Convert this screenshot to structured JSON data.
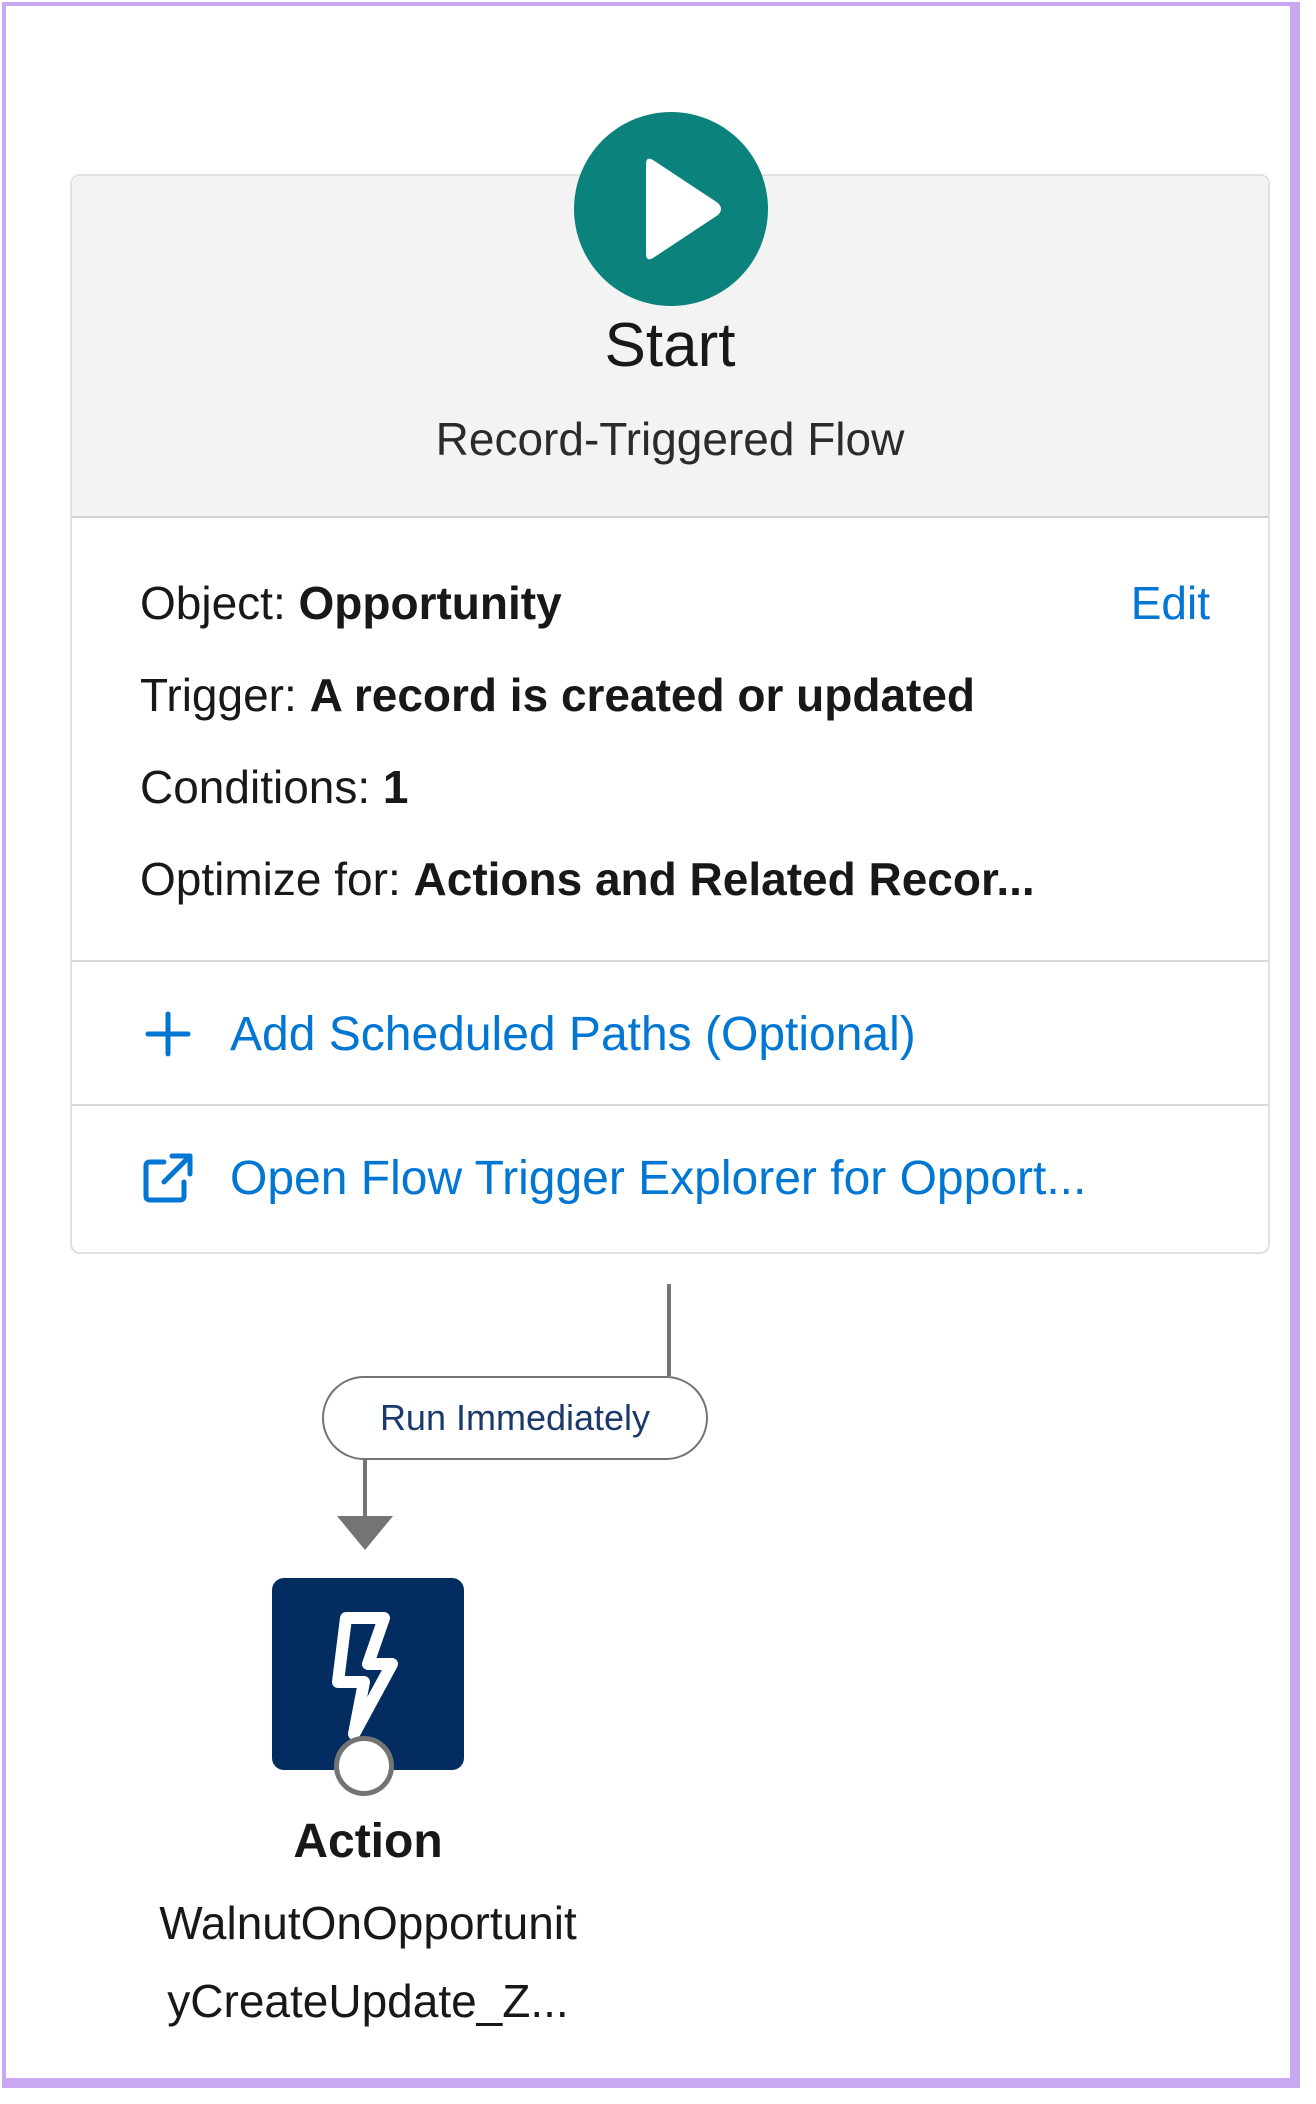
{
  "start": {
    "title": "Start",
    "subtitle": "Record-Triggered Flow",
    "icon": "play-icon",
    "icon_color": "#0b827c"
  },
  "details": {
    "object_label": "Object:",
    "object_value": "Opportunity",
    "edit_label": "Edit",
    "trigger_label": "Trigger:",
    "trigger_value": "A record is created or updated",
    "conditions_label": "Conditions:",
    "conditions_value": "1",
    "optimize_label": "Optimize for:",
    "optimize_value": "Actions and Related Recor..."
  },
  "links": {
    "add_scheduled_paths": "Add Scheduled Paths (Optional)",
    "add_icon": "plus-icon",
    "open_explorer": "Open Flow Trigger Explorer for Opport...",
    "explorer_icon": "external-link-icon",
    "link_color": "#0176d3"
  },
  "connector": {
    "path_label": "Run Immediately"
  },
  "action": {
    "icon": "lightning-bolt-icon",
    "icon_bg": "#032d60",
    "title": "Action",
    "name_line1": "WalnutOnOpportunit",
    "name_line2": "yCreateUpdate_Z..."
  }
}
